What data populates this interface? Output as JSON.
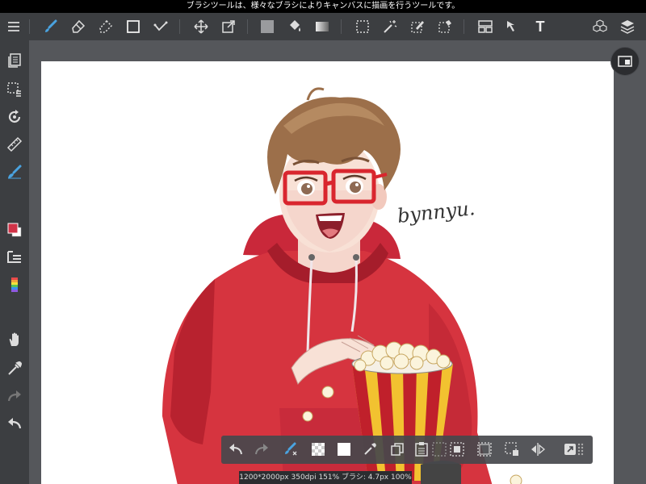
{
  "status_bar": {
    "message": "ブラシツールは、様々なブラシによりキャンバスに描画を行うツールです。"
  },
  "top_toolbar": {
    "menu": "menu-icon",
    "tools": [
      "brush-icon",
      "eraser-icon",
      "dotted-eraser-icon",
      "rectangle-shape-icon",
      "snap-icon",
      "move-icon",
      "transform-icon",
      "fill-color-icon",
      "bucket-icon",
      "gradation-icon",
      "select-icon",
      "magic-wand-icon",
      "select-pen-icon",
      "select-eraser-icon",
      "frame-divider-icon",
      "operation-icon"
    ],
    "text_tool_label": "T",
    "right": [
      "material-icon",
      "layers-icon"
    ]
  },
  "left_toolbar": [
    "layer-panel-icon",
    "selection-layer-icon",
    "rotate-icon",
    "ruler-icon",
    "brush-tool-icon",
    "color-swatch-icon",
    "brush-menu-icon",
    "color-palette-icon",
    "hand-icon",
    "eyedropper-icon",
    "redo-icon",
    "undo-icon"
  ],
  "colors": {
    "foreground": "#d13348",
    "background": "#ffffff",
    "accent": "#4aa3e0"
  },
  "artwork": {
    "signature": "bynnyu."
  },
  "bottom_toolbar": [
    "undo-icon",
    "redo-icon",
    "brush-settings-icon",
    "transparent-color-icon",
    "white-color-icon",
    "eyedropper-icon",
    "copy-icon",
    "paste-icon",
    "deselect-icon",
    "invert-selection-icon",
    "select-all-icon",
    "transform-selection-icon",
    "flip-icon",
    "expand-icon",
    "grip-icon"
  ],
  "canvas_info": "1200*2000px 350dpi 151% ブラシ: 4.7px 100%"
}
